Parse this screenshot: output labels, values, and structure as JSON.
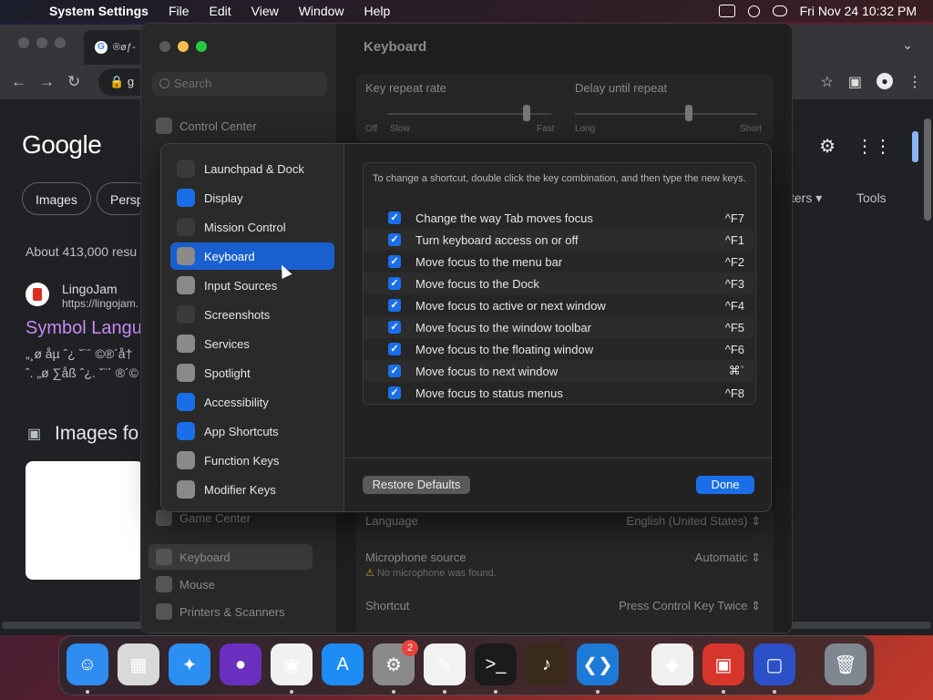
{
  "menubar": {
    "app_name": "System Settings",
    "items": [
      "File",
      "Edit",
      "View",
      "Window",
      "Help"
    ],
    "clock": "Fri Nov 24  10:32 PM"
  },
  "browser": {
    "tab_title": "®øƒ-",
    "url": "g",
    "logo": "Google",
    "chips": [
      "Images",
      "Persp"
    ],
    "filters_label": "ters",
    "tools_label": "Tools",
    "result_count": "About 413,000 resu",
    "site_name": "LingoJam",
    "site_url": "https://lingojam.",
    "result_title": "Symbol Langu",
    "snippet_line1": "„¸ø åµ ˆ¿ ˇ¨´ ©®´å† ",
    "snippet_line2": "ˆ. „ø ∑åß ˆ¿. ˇ¨´ ®´©",
    "images_heading": "Images fo"
  },
  "settings": {
    "search_placeholder": "Search",
    "title": "Keyboard",
    "sidebar_top": "Control Center",
    "sidebar_bottom": [
      "Game Center",
      "Keyboard",
      "Mouse",
      "Printers & Scanners"
    ],
    "key_repeat_label": "Key repeat rate",
    "delay_label": "Delay until repeat",
    "repeat_ticks": [
      "Off",
      "Slow",
      "Fast"
    ],
    "delay_ticks": [
      "Long",
      "Short"
    ],
    "language_label": "Language",
    "language_value": "English (United States)",
    "mic_label": "Microphone source",
    "mic_value": "Automatic",
    "mic_warning": "No microphone was found.",
    "shortcut_label": "Shortcut",
    "shortcut_value": "Press Control Key Twice"
  },
  "sheet": {
    "categories": [
      {
        "label": "Launchpad & Dock",
        "icon": "grid-icon",
        "color": "#3a3a3a"
      },
      {
        "label": "Display",
        "icon": "sun-icon",
        "color": "#1a6fe8"
      },
      {
        "label": "Mission Control",
        "icon": "windows-icon",
        "color": "#3a3a3a"
      },
      {
        "label": "Keyboard",
        "icon": "keyboard-icon",
        "color": "#8a8a8a",
        "selected": true
      },
      {
        "label": "Input Sources",
        "icon": "keyboard-icon",
        "color": "#8a8a8a"
      },
      {
        "label": "Screenshots",
        "icon": "camera-icon",
        "color": "#3a3a3a"
      },
      {
        "label": "Services",
        "icon": "gears-icon",
        "color": "#8a8a8a"
      },
      {
        "label": "Spotlight",
        "icon": "magnifier-icon",
        "color": "#8a8a8a"
      },
      {
        "label": "Accessibility",
        "icon": "accessibility-icon",
        "color": "#1a6fe8"
      },
      {
        "label": "App Shortcuts",
        "icon": "appstore-icon",
        "color": "#1a6fe8"
      },
      {
        "label": "Function Keys",
        "icon": "fn-icon",
        "color": "#8a8a8a"
      },
      {
        "label": "Modifier Keys",
        "icon": "arrow-up-icon",
        "color": "#8a8a8a"
      }
    ],
    "hint": "To change a shortcut, double click the key combination, and then type the new keys.",
    "shortcuts": [
      {
        "label": "Change the way Tab moves focus",
        "key": "^F7"
      },
      {
        "label": "Turn keyboard access on or off",
        "key": "^F1"
      },
      {
        "label": "Move focus to the menu bar",
        "key": "^F2"
      },
      {
        "label": "Move focus to the Dock",
        "key": "^F3"
      },
      {
        "label": "Move focus to active or next window",
        "key": "^F4"
      },
      {
        "label": "Move focus to the window toolbar",
        "key": "^F5"
      },
      {
        "label": "Move focus to the floating window",
        "key": "^F6"
      },
      {
        "label": "Move focus to next window",
        "key": "⌘`"
      },
      {
        "label": "Move focus to status menus",
        "key": "^F8"
      }
    ],
    "restore_label": "Restore Defaults",
    "done_label": "Done"
  },
  "dock": {
    "apps": [
      {
        "name": "finder-icon",
        "color": "#2f8cf0",
        "glyph": "☺"
      },
      {
        "name": "launchpad-icon",
        "color": "#d9d9d9",
        "glyph": "▦"
      },
      {
        "name": "safari-icon",
        "color": "#2a8ff0",
        "glyph": "✦"
      },
      {
        "name": "firefox-icon",
        "color": "#6b2fbf",
        "glyph": "●"
      },
      {
        "name": "chrome-icon",
        "color": "#f1f1f1",
        "glyph": "◉"
      },
      {
        "name": "app-store-icon",
        "color": "#1e8cf5",
        "glyph": "A"
      },
      {
        "name": "system-settings-icon",
        "color": "#8a8a8a",
        "glyph": "⚙",
        "badge": "2"
      },
      {
        "name": "textedit-icon",
        "color": "#f2f2f2",
        "glyph": "✎"
      },
      {
        "name": "terminal-icon",
        "color": "#1b1b1b",
        "glyph": ">_"
      },
      {
        "name": "garageband-icon",
        "color": "#3a2a1a",
        "glyph": "♪"
      },
      {
        "name": "vscode-icon",
        "color": "#1d7ad6",
        "glyph": "❮❯"
      },
      {
        "name": "visual-studio-icon",
        "color": "#f0f0f0",
        "glyph": "◆"
      },
      {
        "name": "photo-booth-icon",
        "color": "#d7352c",
        "glyph": "▣"
      },
      {
        "name": "remote-desktop-icon",
        "color": "#2b50c8",
        "glyph": "▢"
      },
      {
        "name": "trash-icon",
        "color": "#7f8790",
        "glyph": "🗑"
      }
    ]
  },
  "colors": {
    "accent": "#1a6fe8",
    "selected": "#1a5fd0"
  }
}
